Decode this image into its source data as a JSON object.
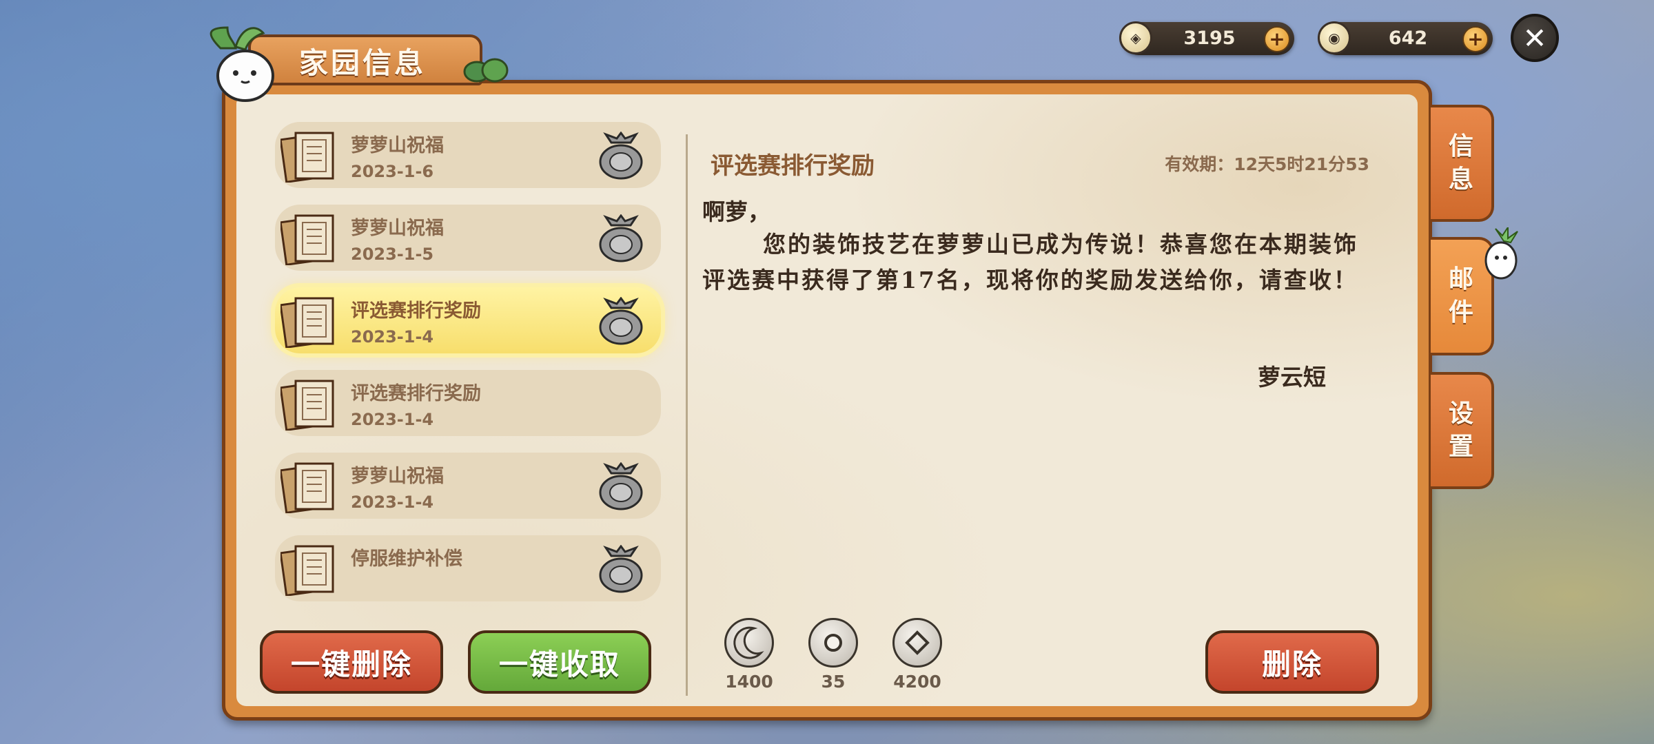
{
  "currency": {
    "coins": {
      "icon": "coin-icon",
      "value": "3195"
    },
    "gems": {
      "icon": "jade-coin-icon",
      "value": "642"
    }
  },
  "title": "家园信息",
  "tabs": [
    {
      "label": "信息",
      "lines": [
        "信",
        "息"
      ],
      "active": false
    },
    {
      "label": "邮件",
      "lines": [
        "邮",
        "件"
      ],
      "active": true
    },
    {
      "label": "设置",
      "lines": [
        "设",
        "置"
      ],
      "active": false
    }
  ],
  "mails": [
    {
      "title": "萝萝山祝福",
      "date": "2023-1-6",
      "has_gift": true,
      "active": false
    },
    {
      "title": "萝萝山祝福",
      "date": "2023-1-5",
      "has_gift": true,
      "active": false
    },
    {
      "title": "评选赛排行奖励",
      "date": "2023-1-4",
      "has_gift": true,
      "active": true
    },
    {
      "title": "评选赛排行奖励",
      "date": "2023-1-4",
      "has_gift": false,
      "active": false
    },
    {
      "title": "萝萝山祝福",
      "date": "2023-1-4",
      "has_gift": true,
      "active": false
    },
    {
      "title": "停服维护补偿",
      "date": "",
      "has_gift": true,
      "active": false
    }
  ],
  "buttons": {
    "delete_all": "一键删除",
    "collect_all": "一键收取",
    "delete": "删除"
  },
  "detail": {
    "title": "评选赛排行奖励",
    "expiry": "有效期：12天5时21分53",
    "greeting": "啊萝，",
    "body": "您的装饰技艺在萝萝山已成为传说！恭喜您在本期装饰评选赛中获得了第17名，现将你的奖励发送给你，请查收！",
    "signature": "萝云短"
  },
  "rewards": [
    {
      "icon": "moon-icon",
      "amount": "1400"
    },
    {
      "icon": "jade-coin-icon",
      "amount": "35"
    },
    {
      "icon": "coin-icon",
      "amount": "4200"
    }
  ]
}
